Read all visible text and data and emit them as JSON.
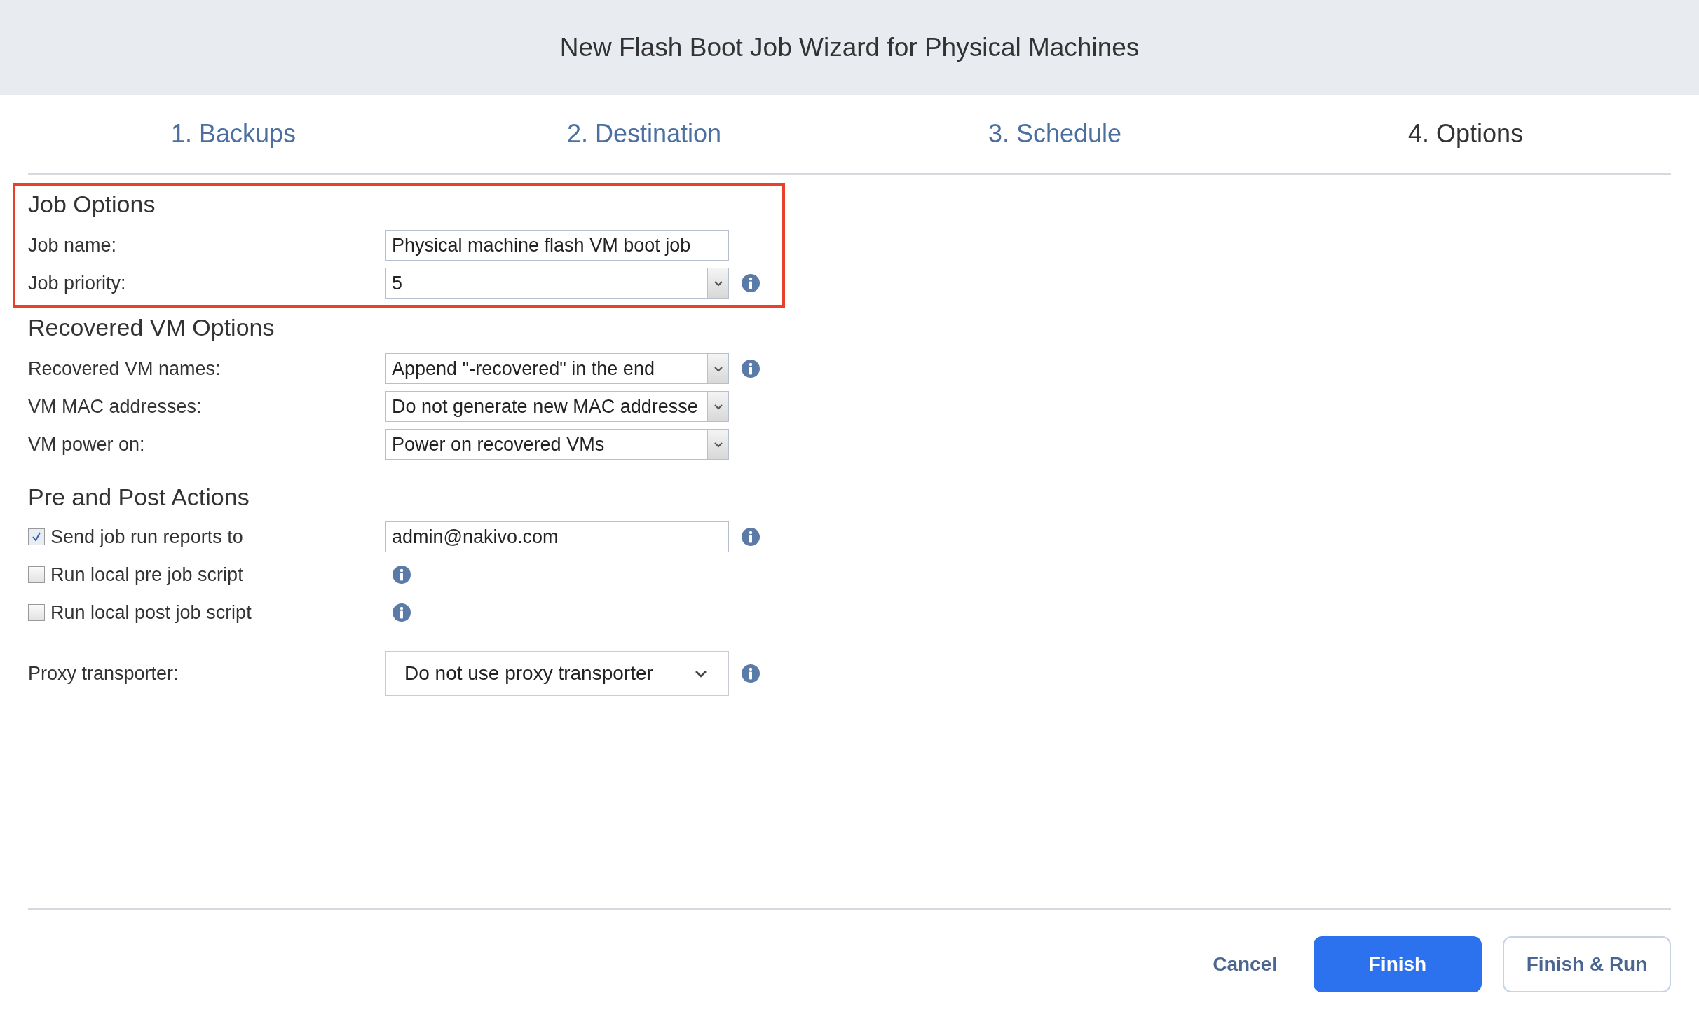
{
  "window": {
    "title": "New Flash Boot Job Wizard for Physical Machines"
  },
  "tabs": [
    {
      "label": "1. Backups",
      "selected": false
    },
    {
      "label": "2. Destination",
      "selected": false
    },
    {
      "label": "3. Schedule",
      "selected": false
    },
    {
      "label": "4. Options",
      "selected": true
    }
  ],
  "sections": [
    {
      "heading": "Job Options",
      "highlighted": true,
      "rows": [
        {
          "kind": "text",
          "label": "Job name:",
          "value": "Physical machine flash VM boot job",
          "info": false
        },
        {
          "kind": "select",
          "label": "Job priority:",
          "value": "5",
          "info": true
        }
      ]
    },
    {
      "heading": "Recovered VM Options",
      "highlighted": false,
      "rows": [
        {
          "kind": "select",
          "label": "Recovered VM names:",
          "value": "Append \"-recovered\" in the end",
          "info": true
        },
        {
          "kind": "select",
          "label": "VM MAC addresses:",
          "value": "Do not generate new MAC addresse",
          "info": false
        },
        {
          "kind": "select",
          "label": "VM power on:",
          "value": "Power on recovered VMs",
          "info": false
        }
      ]
    },
    {
      "heading": "Pre and Post Actions",
      "highlighted": false,
      "rows": [
        {
          "kind": "checkbox",
          "label": "Send job run reports to",
          "checked": true,
          "value": "admin@nakivo.com",
          "info": true
        },
        {
          "kind": "checkbox",
          "label": "Run local pre job script",
          "checked": false,
          "info": true
        },
        {
          "kind": "checkbox",
          "label": "Run local post job script",
          "checked": false,
          "info": true
        }
      ]
    }
  ],
  "proxy": {
    "label": "Proxy transporter:",
    "value": "Do not use proxy transporter",
    "info": true
  },
  "buttons": [
    {
      "label": "Cancel",
      "kind": "link"
    },
    {
      "label": "Finish",
      "kind": "primary"
    },
    {
      "label": "Finish & Run",
      "kind": "outline"
    }
  ]
}
